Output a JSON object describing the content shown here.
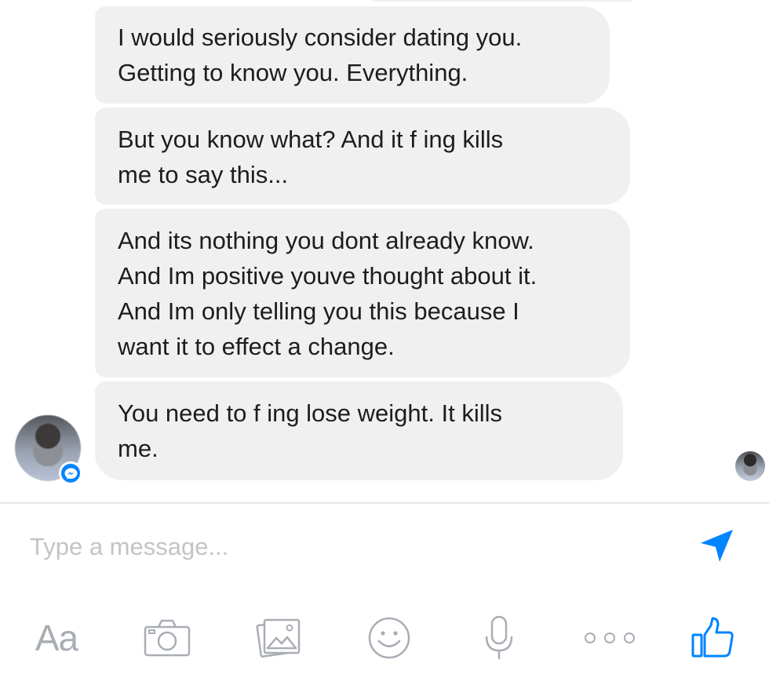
{
  "messages": [
    {
      "text": "I would seriously consider dating you.\nGetting to know you. Everything."
    },
    {
      "text": "But you know what? And it f       ing kills\nme to say this..."
    },
    {
      "text": "And its nothing you dont already know.\nAnd Im positive youve thought about it.\nAnd Im only telling you this because I\nwant it to effect a change."
    },
    {
      "text": "You need to f        ing lose weight. It kills\nme."
    }
  ],
  "composer": {
    "placeholder": "Type a message...",
    "value": ""
  },
  "toolbar": {
    "text_format_label": "Aa",
    "icons": [
      "camera-icon",
      "photo-icon",
      "emoji-icon",
      "microphone-icon",
      "more-icon",
      "thumbs-up-icon"
    ]
  },
  "colors": {
    "bubble": "#f0f0f0",
    "accent": "#0084ff",
    "toolbar_icon": "#a9adb4"
  }
}
